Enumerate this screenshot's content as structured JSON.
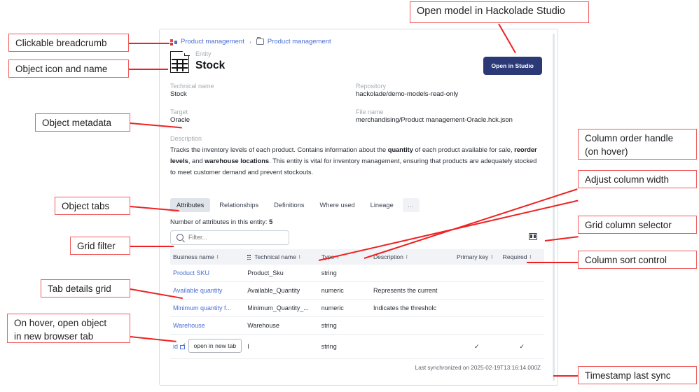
{
  "annotations": [
    {
      "id": "a-breadcrumb",
      "text": "Clickable breadcrumb"
    },
    {
      "id": "a-icon-name",
      "text": "Object icon and name"
    },
    {
      "id": "a-metadata",
      "text": "Object metadata"
    },
    {
      "id": "a-tabs",
      "text": "Object tabs"
    },
    {
      "id": "a-filter",
      "text": "Grid filter"
    },
    {
      "id": "a-details-grid",
      "text": "Tab details grid"
    },
    {
      "id": "a-hover-newtab",
      "text": "On hover, open object\nin new browser tab"
    },
    {
      "id": "a-open-studio",
      "text": "Open model in Hackolade Studio"
    },
    {
      "id": "a-col-order",
      "text": "Column order handle\n(on hover)"
    },
    {
      "id": "a-col-width",
      "text": "Adjust column width"
    },
    {
      "id": "a-col-selector",
      "text": "Grid column selector"
    },
    {
      "id": "a-col-sort",
      "text": "Column sort control"
    },
    {
      "id": "a-timestamp",
      "text": "Timestamp last sync"
    }
  ],
  "app": {
    "breadcrumb": {
      "model_icon": "model-icon",
      "model_label": "Product management",
      "separator": "›",
      "folder_icon": "folder-icon",
      "folder_label": "Product management"
    },
    "header": {
      "object_icon": "entity-icon",
      "kicker": "Entity",
      "name": "Stock",
      "studio_button": "Open in Studio",
      "accent_color": "#2b3a77"
    },
    "metadata": [
      {
        "label": "Technical name",
        "value": "Stock"
      },
      {
        "label": "Repository",
        "value": "hackolade/demo-models-read-only"
      },
      {
        "label": "Target",
        "value": "Oracle"
      },
      {
        "label": "File name",
        "value": "merchandising/Product management-Oracle.hck.json"
      }
    ],
    "description": {
      "label": "Description",
      "parts": [
        {
          "t": "Tracks the inventory levels of each product. Contains information about the ",
          "b": false
        },
        {
          "t": "quantity",
          "b": true
        },
        {
          "t": " of each product available for sale, ",
          "b": false
        },
        {
          "t": "reorder levels",
          "b": true
        },
        {
          "t": ", and ",
          "b": false
        },
        {
          "t": "warehouse locations",
          "b": true
        },
        {
          "t": ". This entity is vital for inventory management, ensuring that products are adequately stocked to meet customer demand and prevent stockouts.",
          "b": false
        }
      ]
    },
    "tabs": [
      {
        "label": "Attributes",
        "active": true
      },
      {
        "label": "Relationships",
        "active": false
      },
      {
        "label": "Definitions",
        "active": false
      },
      {
        "label": "Where used",
        "active": false
      },
      {
        "label": "Lineage",
        "active": false
      },
      {
        "label": "…",
        "active": false,
        "overflow": true
      }
    ],
    "grid": {
      "count_prefix": "Number of attributes in this entity: ",
      "count_value": "5",
      "filter_placeholder": "Filter...",
      "filter_value": "",
      "search_icon": "search-icon",
      "column_selector_icon": "grid-column-selector-icon",
      "sort_icon": "sort-updown-icon",
      "drag_handle_icon": "column-order-handle-icon",
      "columns": [
        {
          "label": "Business name",
          "sortable": true,
          "handle": false
        },
        {
          "label": "Technical name",
          "sortable": true,
          "handle": true
        },
        {
          "label": "Type",
          "sortable": true,
          "handle": false
        },
        {
          "label": "Description",
          "sortable": true,
          "handle": false
        },
        {
          "label": "Primary key",
          "sortable": true,
          "handle": false
        },
        {
          "label": "Required",
          "sortable": true,
          "handle": false
        }
      ],
      "rows": [
        {
          "business_name": "Product SKU",
          "technical_name": "Product_Sku",
          "type": "string",
          "description": "",
          "primary_key": "",
          "required": ""
        },
        {
          "business_name": "Available quantity",
          "technical_name": "Available_Quantity",
          "type": "numeric",
          "description": "Represents the current",
          "primary_key": "",
          "required": ""
        },
        {
          "business_name": "Minimum quantity f...",
          "technical_name": "Minimum_Quantity_...",
          "type": "numeric",
          "description": "Indicates the thresholc",
          "primary_key": "",
          "required": ""
        },
        {
          "business_name": "Warehouse",
          "technical_name": "Warehouse",
          "type": "string",
          "description": "",
          "primary_key": "",
          "required": ""
        },
        {
          "business_name": "id",
          "technical_name": "I",
          "type": "string",
          "description": "",
          "primary_key": "✓",
          "required": "✓",
          "hover": true,
          "tooltip": "open in new tab",
          "newtab_icon": "open-in-new-tab-icon"
        }
      ]
    },
    "footer": {
      "sync_text": "Last synchronized on 2025-02-19T13:16:14.000Z"
    }
  }
}
